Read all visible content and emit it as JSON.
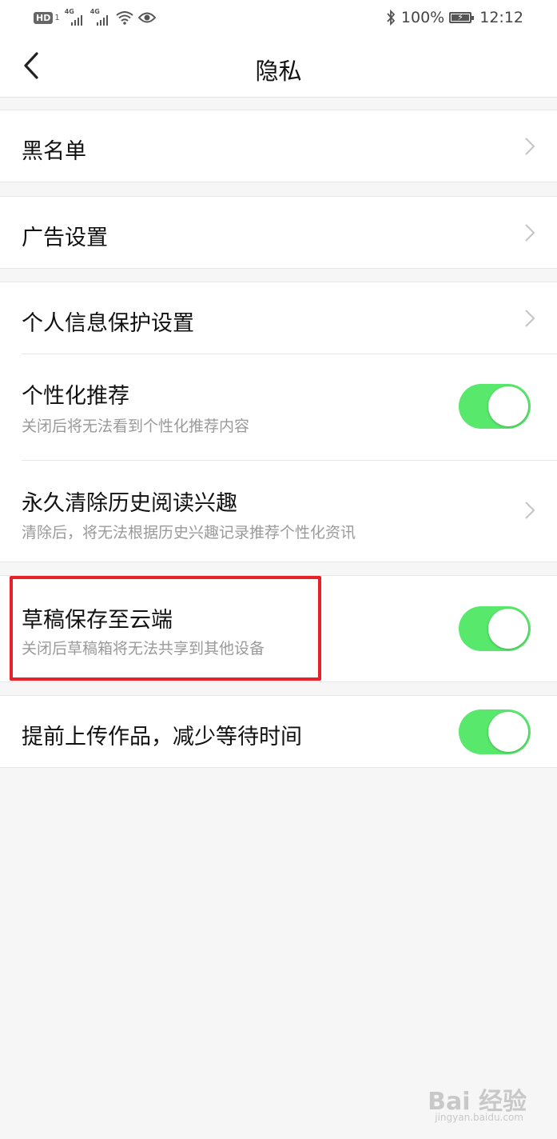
{
  "status_bar": {
    "hd": "HD",
    "network1": "4G",
    "network2": "4G",
    "battery": "100%",
    "battery_level": 1.0,
    "time": "12:12",
    "icons": [
      "hd-icon",
      "signal-icon",
      "wifi-icon",
      "eye-icon",
      "bluetooth-icon",
      "battery-icon"
    ]
  },
  "nav": {
    "title": "隐私",
    "back_icon": "back-arrow-icon"
  },
  "items": {
    "blacklist": {
      "label": "黑名单"
    },
    "ad_settings": {
      "label": "广告设置"
    },
    "personal_info": {
      "label": "个人信息保护设置"
    },
    "personalized": {
      "label": "个性化推荐",
      "desc": "关闭后将无法看到个性化推荐内容",
      "on": true
    },
    "clear_history": {
      "label": "永久清除历史阅读兴趣",
      "desc": "清除后，将无法根据历史兴趣记录推荐个性化资讯"
    },
    "draft_cloud": {
      "label": "草稿保存至云端",
      "desc": "关闭后草稿箱将无法共享到其他设备",
      "on": true
    },
    "pre_upload": {
      "label": "提前上传作品，减少等待时间",
      "on": true
    }
  },
  "colors": {
    "toggle_on": "#58e96c",
    "highlight": "#e8202a"
  },
  "watermark": {
    "text": "Bai 经验",
    "url": "jingyan.baidu.com"
  }
}
